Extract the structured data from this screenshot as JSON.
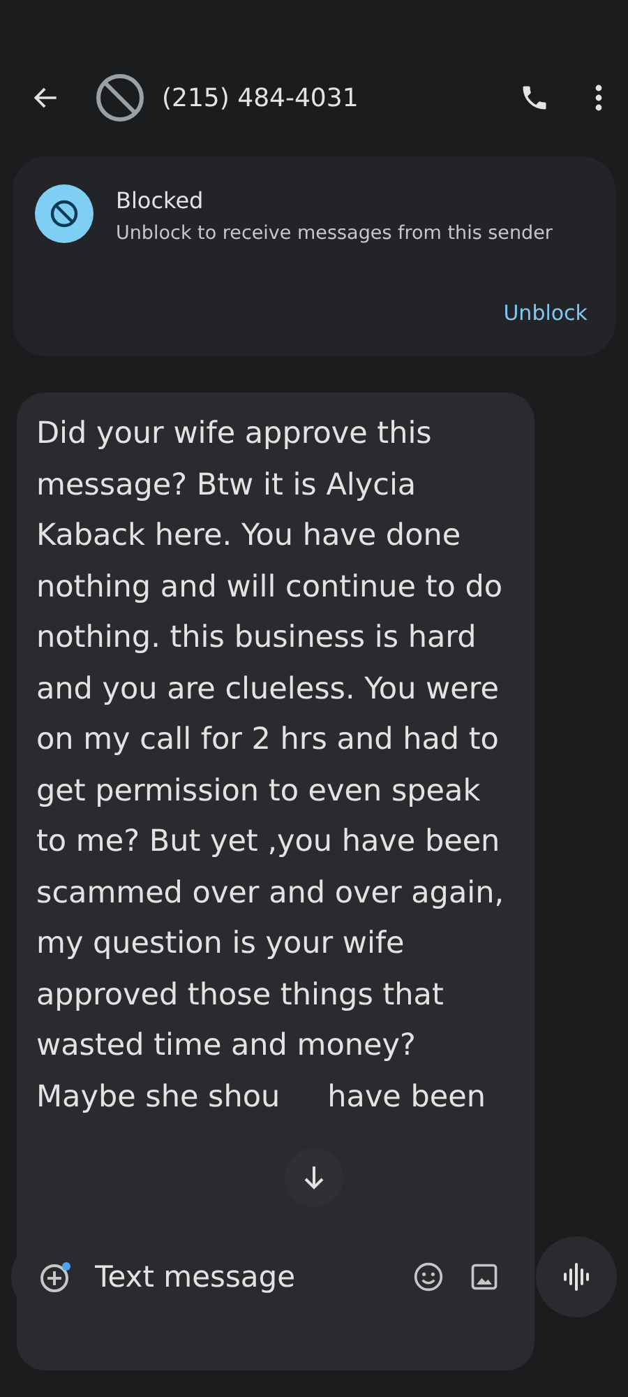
{
  "header": {
    "phone_number": "(215) 484-4031"
  },
  "blocked_banner": {
    "title": "Blocked",
    "message": "Unblock to receive messages from this sender",
    "action": "Unblock"
  },
  "messages": [
    {
      "text": "Did your wife approve this message? Btw it is Alycia Kaback here. You have done nothing and will continue to do nothing. this business is hard and you are clueless. You were on my call for 2 hrs and had to get permission to even speak to me? But yet ,you have been scammed over and over again, my question is your wife approved those things that wasted time and money?",
      "last_line": [
        "Maybe she shou",
        "have been"
      ]
    }
  ],
  "composer": {
    "placeholder": "Text message"
  }
}
